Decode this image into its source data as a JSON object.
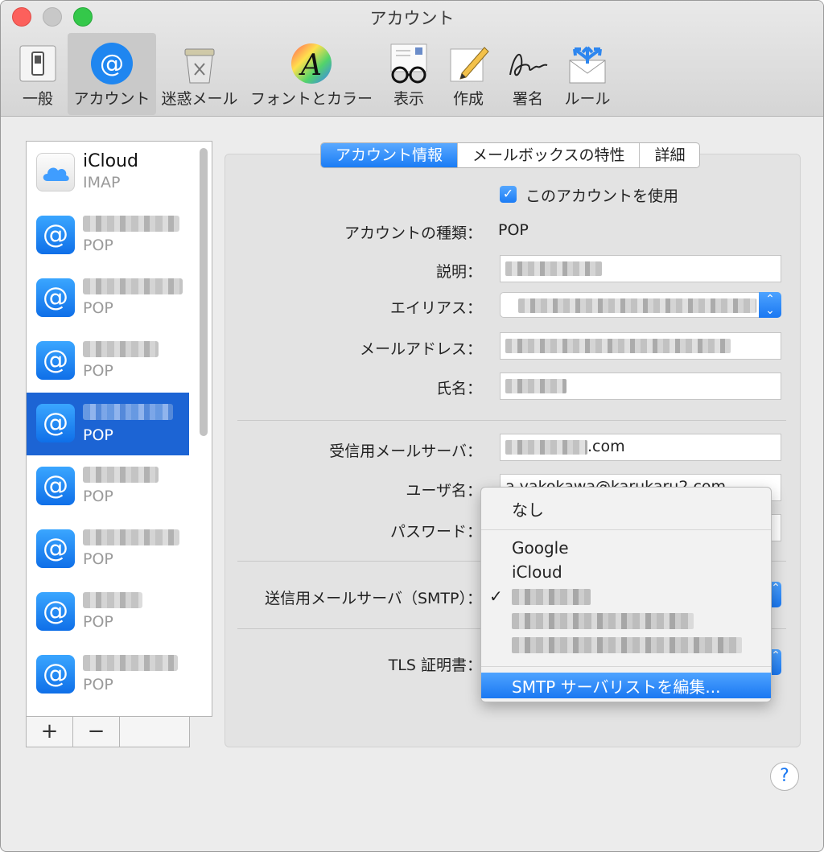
{
  "window": {
    "title": "アカウント"
  },
  "toolbar": {
    "items": [
      {
        "label": "一般",
        "icon": "general-switch-icon"
      },
      {
        "label": "アカウント",
        "icon": "at-sign-icon"
      },
      {
        "label": "迷惑メール",
        "icon": "junk-trash-icon"
      },
      {
        "label": "フォントとカラー",
        "icon": "font-color-icon"
      },
      {
        "label": "表示",
        "icon": "view-glasses-icon"
      },
      {
        "label": "作成",
        "icon": "compose-pencil-icon"
      },
      {
        "label": "署名",
        "icon": "signature-icon"
      },
      {
        "label": "ルール",
        "icon": "rules-envelope-icon"
      }
    ],
    "selected": "アカウント"
  },
  "accounts": [
    {
      "name": "iCloud",
      "type": "IMAP",
      "icon": "icloud-icon"
    },
    {
      "name": "",
      "type": "POP",
      "icon": "at-sign-icon"
    },
    {
      "name": "",
      "type": "POP",
      "icon": "at-sign-icon"
    },
    {
      "name": "",
      "type": "POP",
      "icon": "at-sign-icon"
    },
    {
      "name": "",
      "type": "POP",
      "icon": "at-sign-icon",
      "selected": true
    },
    {
      "name": "",
      "type": "POP",
      "icon": "at-sign-icon"
    },
    {
      "name": "",
      "type": "POP",
      "icon": "at-sign-icon"
    },
    {
      "name": "",
      "type": "POP",
      "icon": "at-sign-icon"
    },
    {
      "name": "",
      "type": "POP",
      "icon": "at-sign-icon"
    }
  ],
  "list_buttons": {
    "add": "+",
    "remove": "−"
  },
  "tabs": [
    {
      "label": "アカウント情報",
      "active": true
    },
    {
      "label": "メールボックスの特性",
      "active": false
    },
    {
      "label": "詳細",
      "active": false
    }
  ],
  "form": {
    "enable_label": "このアカウントを使用",
    "enable_checked": true,
    "type_label": "アカウントの種類：",
    "type_value": "POP",
    "description_label": "説明：",
    "alias_label": "エイリアス：",
    "email_label": "メールアドレス：",
    "fullname_label": "氏名：",
    "incoming_label": "受信用メールサーバ：",
    "incoming_value_suffix": ".com",
    "username_label": "ユーザ名：",
    "username_value": "a.yakokawa@karukaru2.com",
    "password_label": "パスワード：",
    "smtp_label": "送信用メールサーバ（SMTP）：",
    "tls_label": "TLS 証明書："
  },
  "smtp_menu": {
    "none": "なし",
    "items": [
      "Google",
      "iCloud"
    ],
    "edit": "SMTP サーバリストを編集..."
  },
  "help": {
    "label": "?"
  },
  "colors": {
    "accent": "#1a78f2",
    "selection": "#1c64d4"
  }
}
